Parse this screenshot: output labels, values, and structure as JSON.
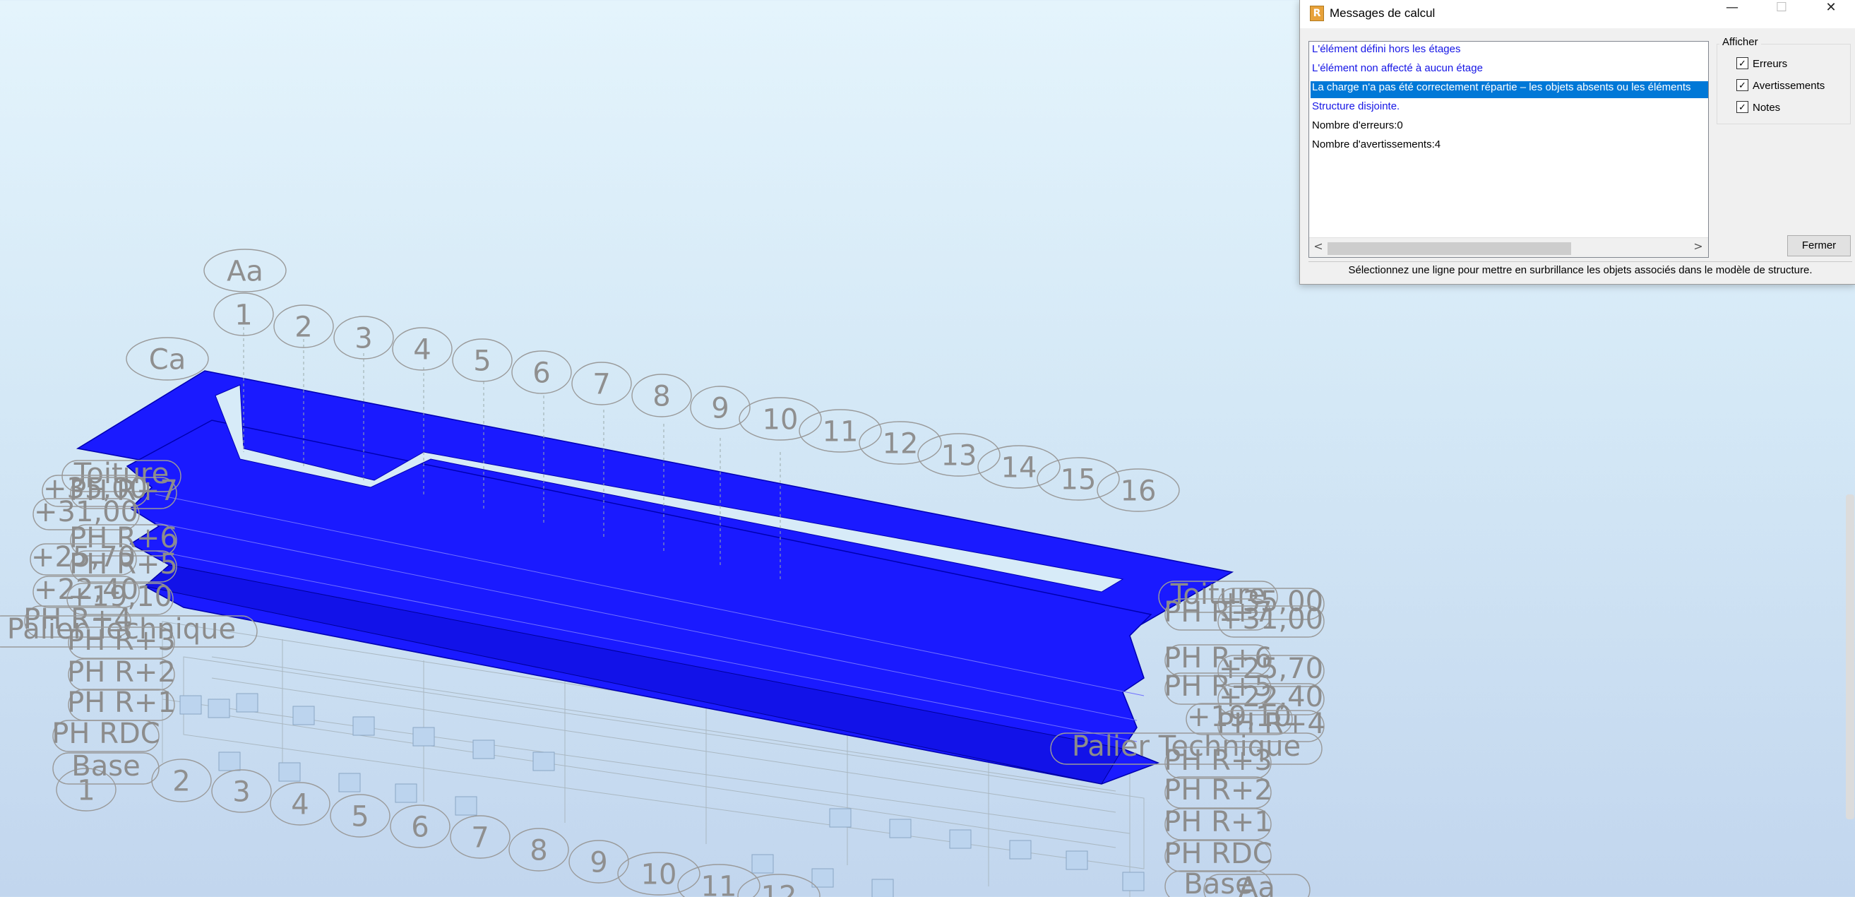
{
  "viewport": {
    "grid_bubbles_top": [
      "Aa",
      "1",
      "2",
      "3",
      "4",
      "5",
      "6",
      "7",
      "8",
      "9",
      "10",
      "11",
      "12",
      "13",
      "14",
      "15",
      "16",
      "Ca"
    ],
    "grid_bubbles_bottom": [
      "1",
      "2",
      "3",
      "4",
      "5",
      "6",
      "7",
      "8",
      "9",
      "10",
      "11",
      "12"
    ],
    "level_labels_left": [
      "Toiture",
      "+35,00",
      "+31,00",
      "PH R+7",
      "PH R+6",
      "+25,70",
      "PH R+5",
      "+22,40",
      "+19,10",
      "PH R+4",
      "Palier Technique",
      "PH R+3",
      "PH R+2",
      "PH R+1",
      "PH RDC",
      "Base"
    ],
    "level_labels_right": [
      "Toiture",
      "+35,00",
      "PH R+7",
      "+31,00",
      "PH R+6",
      "+25,70",
      "PH R+5",
      "+22,40",
      "+19,10",
      "PH R+4",
      "Palier Technique",
      "PH R+3",
      "PH R+2",
      "PH R+1",
      "PH RDC",
      "Base",
      "Aa"
    ],
    "slab_color": "#1a1aff"
  },
  "dialog": {
    "title": "Messages de calcul",
    "app_icon": "R",
    "messages": [
      {
        "text": "L'élément défini hors les étages",
        "style": "blue"
      },
      {
        "text": "L'élément non affecté à aucun étage",
        "style": "blue"
      },
      {
        "text": "La charge n'a pas été correctement répartie – les objets absents ou les éléments",
        "style": "selected"
      },
      {
        "text": "Structure disjointe.",
        "style": "blue"
      },
      {
        "text": "Nombre d'erreurs:0",
        "style": "black"
      },
      {
        "text": "Nombre d'avertissements:4",
        "style": "black"
      }
    ],
    "afficher_label": "Afficher",
    "checkboxes": [
      {
        "label": "Erreurs",
        "checked": true
      },
      {
        "label": "Avertissements",
        "checked": true
      },
      {
        "label": "Notes",
        "checked": true
      }
    ],
    "close_button": "Fermer",
    "status_text": "Sélectionnez une ligne pour mettre en surbrillance les objets associés dans le modèle de structure."
  }
}
